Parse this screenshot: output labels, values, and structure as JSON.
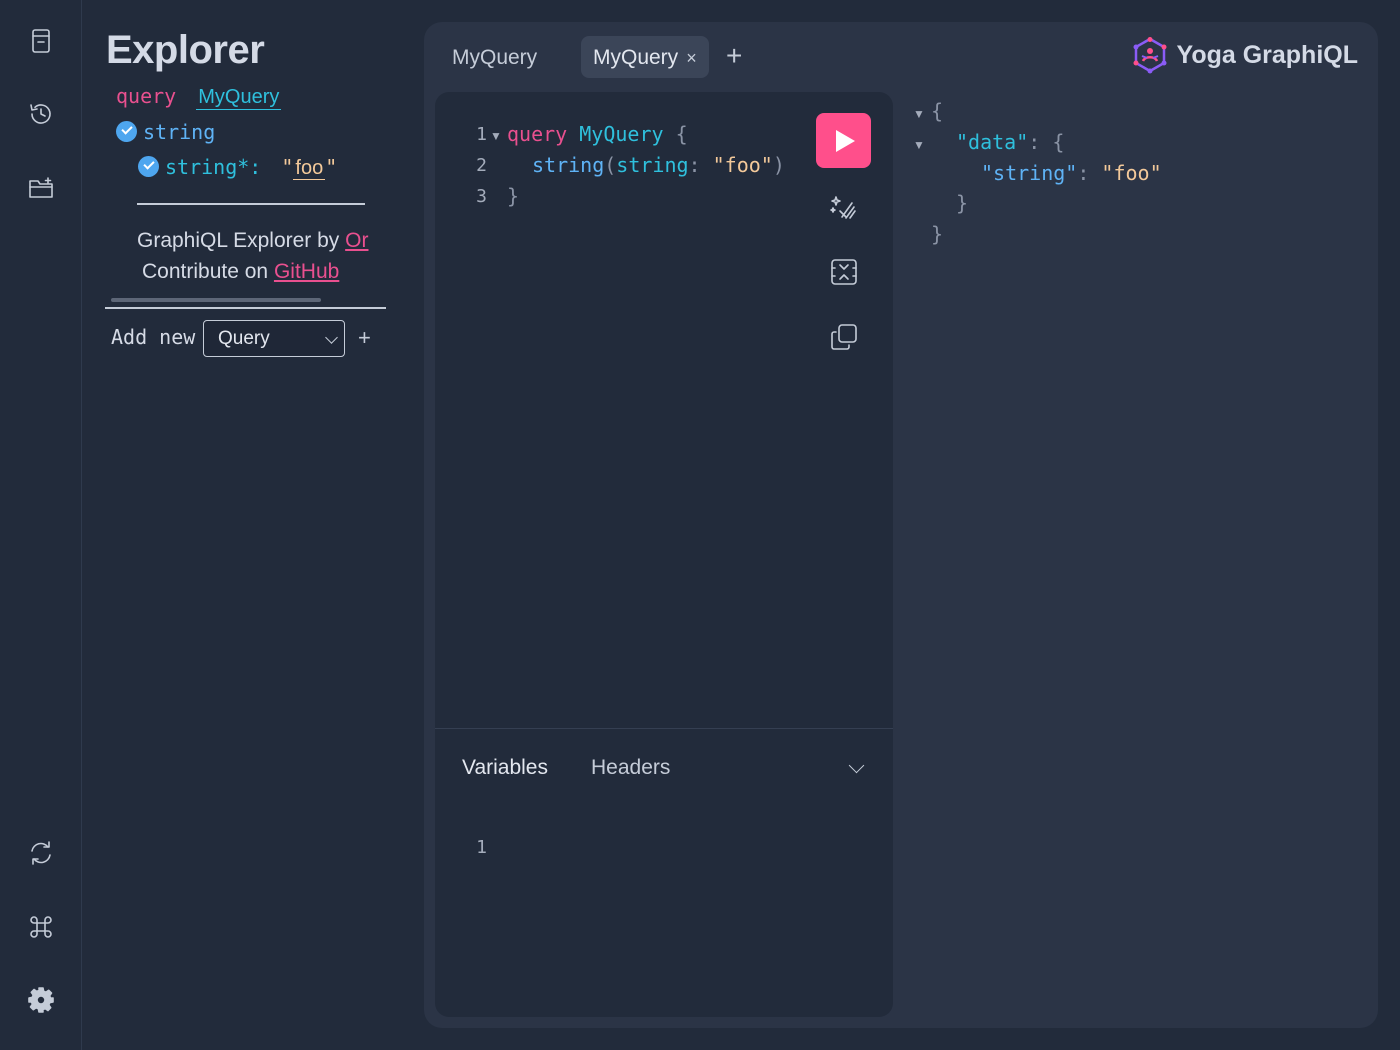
{
  "explorer": {
    "title": "Explorer",
    "operation_keyword": "query",
    "operation_name": "MyQuery",
    "field_name": "string",
    "arg_name": "string*:",
    "arg_quote_open": "\"",
    "arg_value": "foo",
    "arg_quote_close": "\"",
    "credit_line1_prefix": "GraphiQL Explorer by",
    "credit_line1_link": "Or",
    "credit_line2_prefix": "Contribute on",
    "credit_line2_link": "GitHub",
    "add_new_label": "Add new",
    "operation_type_selected": "Query",
    "add_button": "+"
  },
  "tabs": [
    {
      "label": "MyQuery"
    },
    {
      "label": "MyQuery",
      "close": "×"
    }
  ],
  "tab_add": "+",
  "brand": {
    "name": "Yoga GraphiQL",
    "accent": "#ff4f8b"
  },
  "editor": {
    "lines": [
      {
        "no": "1",
        "kw": "query",
        "name": "MyQuery",
        "brace": "{"
      },
      {
        "no": "2",
        "field": "string",
        "paren_open": "(",
        "arg": "string",
        "colon": ":",
        "value": "\"foo\"",
        "paren_close": ")"
      },
      {
        "no": "3",
        "brace": "}"
      }
    ],
    "tools": [
      "prettify-icon",
      "merge-fragments-icon",
      "copy-icon"
    ]
  },
  "variables_panel": {
    "tab_variables": "Variables",
    "tab_headers": "Headers",
    "line_no": "1"
  },
  "result": {
    "open_brace": "{",
    "data_key": "\"data\"",
    "colon": ":",
    "data_open": "{",
    "string_key": "\"string\"",
    "string_value": "\"foo\"",
    "data_close": "}",
    "close_brace": "}"
  },
  "colors": {
    "keyword": "#e9508f",
    "name": "#2fc0dd",
    "field": "#5fb3f6",
    "string": "#f3c99a",
    "run_button": "#ff4f8b"
  }
}
